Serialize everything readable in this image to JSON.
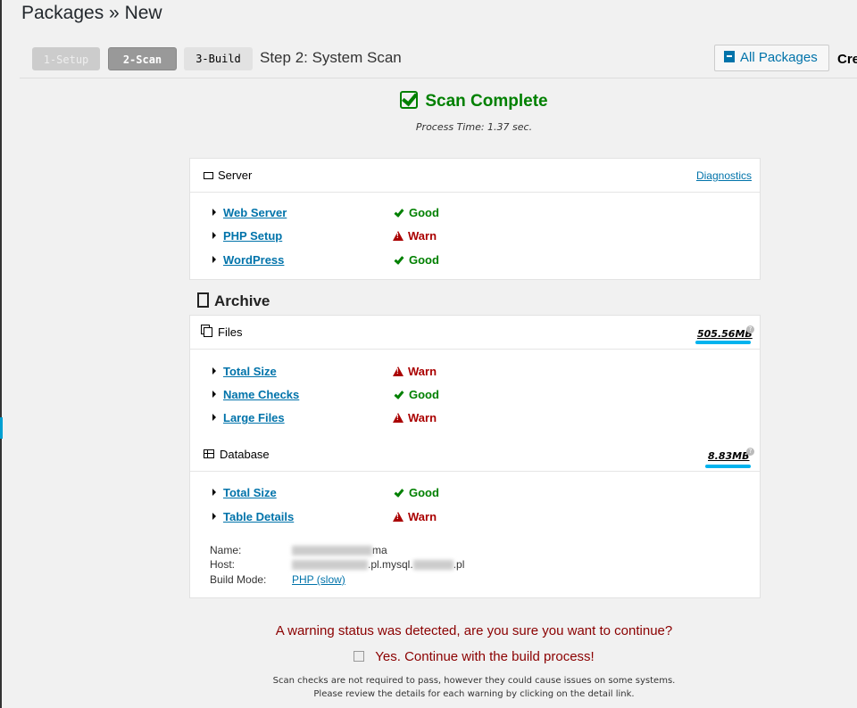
{
  "page": {
    "title": "Packages » New"
  },
  "steps": [
    {
      "label": "1-Setup"
    },
    {
      "label": "2-Scan"
    },
    {
      "label": "3-Build"
    }
  ],
  "step_label": "Step 2: System Scan",
  "all_packages": "All Packages",
  "create_partial": "Cre",
  "scan": {
    "title": "Scan Complete",
    "process_time": "Process Time: 1.37 sec."
  },
  "server": {
    "title": "Server",
    "diagnostics": "Diagnostics",
    "rows": [
      {
        "label": "Web Server",
        "status": "Good"
      },
      {
        "label": "PHP Setup",
        "status": "Warn"
      },
      {
        "label": "WordPress",
        "status": "Good"
      }
    ]
  },
  "archive": {
    "title": "Archive",
    "files": {
      "title": "Files",
      "size": "505.56MB",
      "rows": [
        {
          "label": "Total Size",
          "status": "Warn"
        },
        {
          "label": "Name Checks",
          "status": "Good"
        },
        {
          "label": "Large Files",
          "status": "Warn"
        }
      ]
    },
    "database": {
      "title": "Database",
      "size": "8.83MB",
      "rows": [
        {
          "label": "Total Size",
          "status": "Good"
        },
        {
          "label": "Table Details",
          "status": "Warn"
        }
      ],
      "name_label": "Name:",
      "name_value_visible": "ma",
      "host_label": "Host:",
      "host_value_visible_1": ".pl.mysql.",
      "host_value_visible_2": ".pl",
      "build_mode_label": "Build Mode:",
      "build_mode_value": "PHP (slow)"
    }
  },
  "footer": {
    "warning": "A warning status was detected, are you sure you want to continue?",
    "confirm": "Yes. Continue with the build process!",
    "note1": "Scan checks are not required to pass, however they could cause issues on some systems.",
    "note2": "Please review the details for each warning by clicking on the detail link."
  },
  "colors": {
    "good": "#008000",
    "warn": "#aa0000",
    "link": "#0073aa",
    "size_underline": "#00b3ee"
  }
}
